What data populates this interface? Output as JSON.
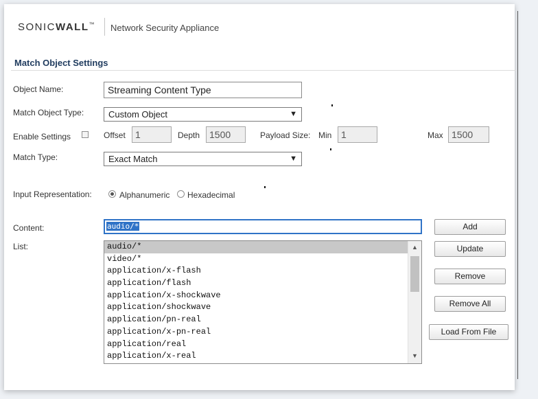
{
  "header": {
    "logo_brand_light": "SONIC",
    "logo_brand_bold": "WALL",
    "logo_tm": "™",
    "app_name": "Network Security Appliance"
  },
  "section": {
    "title": "Match Object Settings"
  },
  "form": {
    "object_name": {
      "label": "Object Name:",
      "value": "Streaming Content Type"
    },
    "match_object_type": {
      "label": "Match Object Type:",
      "value": "Custom Object"
    },
    "enable_settings": {
      "label": "Enable Settings",
      "checked": false,
      "offset_label": "Offset",
      "offset_value": "1",
      "depth_label": "Depth",
      "depth_value": "1500",
      "payload_size_label": "Payload Size:",
      "min_label": "Min",
      "min_value": "1",
      "max_label": "Max",
      "max_value": "1500"
    },
    "match_type": {
      "label": "Match Type:",
      "value": "Exact Match"
    },
    "input_representation": {
      "label": "Input Representation:",
      "options": [
        "Alphanumeric",
        "Hexadecimal"
      ],
      "selected": "Alphanumeric"
    },
    "content": {
      "label": "Content:",
      "value": "audio/*"
    },
    "list": {
      "label": "List:",
      "items": [
        "audio/*",
        "video/*",
        "application/x-flash",
        "application/flash",
        "application/x-shockwave",
        "application/shockwave",
        "application/pn-real",
        "application/x-pn-real",
        "application/real",
        "application/x-real"
      ],
      "selected_index": 0
    }
  },
  "buttons": {
    "add": "Add",
    "update": "Update",
    "remove": "Remove",
    "remove_all": "Remove All",
    "load_from_file": "Load From File"
  },
  "colors": {
    "section_title": "#1f3b5e",
    "focus_border": "#2f73c7",
    "selected_row": "#c8c8c8"
  }
}
